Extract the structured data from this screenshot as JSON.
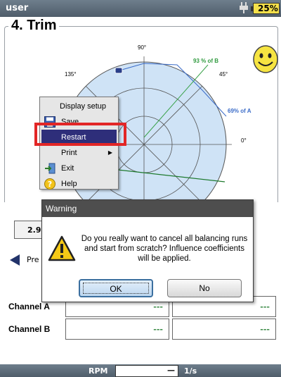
{
  "header": {
    "user": "user",
    "battery": "25%"
  },
  "step": {
    "title": "4. Trim"
  },
  "polar_chart": {
    "angle_labels": {
      "a90": "90°",
      "a45": "45°",
      "a135": "135°",
      "a0": "0°"
    },
    "annotations": {
      "b": "93 % of B",
      "a": "69% of A"
    }
  },
  "context_menu": {
    "items": [
      {
        "label": "Display setup",
        "icon": ""
      },
      {
        "label": "Save",
        "icon": "save-icon"
      },
      {
        "label": "Restart",
        "icon": ""
      },
      {
        "label": "Print",
        "icon": ""
      },
      {
        "label": "Exit",
        "icon": "exit-icon"
      },
      {
        "label": "Help",
        "icon": "help-icon"
      }
    ],
    "selected": "Restart"
  },
  "background": {
    "value_box": "2.9",
    "prev_label": "Pre",
    "rows": [
      {
        "label": "Channel A",
        "cells": [
          "---",
          "---"
        ]
      },
      {
        "label": "Channel B",
        "cells": [
          "---",
          "---"
        ]
      }
    ]
  },
  "dialog": {
    "title": "Warning",
    "message": "Do you really want to cancel all balancing runs and start from scratch? Influence coefficients will be applied.",
    "ok_label": "OK",
    "no_label": "No"
  },
  "footer": {
    "rpm_label": "RPM",
    "rpm_value": "—",
    "rpm_unit": "1/s"
  },
  "colors": {
    "menu_selected": "#2e2e7a",
    "highlight": "#e22626",
    "battery": "#f4e04a",
    "plot_green": "#3aa24a",
    "plot_blue": "#3a6bc8"
  }
}
